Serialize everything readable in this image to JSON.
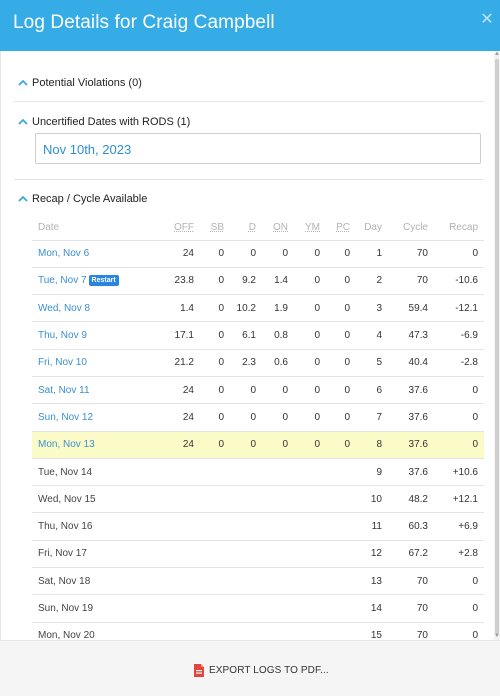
{
  "header": {
    "title": "Log Details for Craig Campbell",
    "close_icon": "close-icon"
  },
  "sections": {
    "violations": {
      "label": "Potential Violations (0)"
    },
    "uncertified": {
      "label": "Uncertified Dates with RODS (1)",
      "date": "Nov 10th, 2023"
    },
    "recap": {
      "label": "Recap / Cycle Available"
    }
  },
  "table": {
    "headers": {
      "date": "Date",
      "off": "OFF",
      "sb": "SB",
      "d": "D",
      "on": "ON",
      "ym": "YM",
      "pc": "PC",
      "day": "Day",
      "cycle": "Cycle",
      "recap": "Recap"
    },
    "rows": [
      {
        "date": "Mon, Nov 6",
        "off": "24",
        "sb": "0",
        "d": "0",
        "on": "0",
        "ym": "0",
        "pc": "0",
        "day": "1",
        "cycle": "70",
        "recap": "0"
      },
      {
        "date": "Tue, Nov 7",
        "badge": "Restart",
        "off": "23.8",
        "sb": "0",
        "d": "9.2",
        "on": "1.4",
        "ym": "0",
        "pc": "0",
        "day": "2",
        "cycle": "70",
        "recap": "-10.6"
      },
      {
        "date": "Wed, Nov 8",
        "off": "1.4",
        "sb": "0",
        "d": "10.2",
        "on": "1.9",
        "ym": "0",
        "pc": "0",
        "day": "3",
        "cycle": "59.4",
        "recap": "-12.1"
      },
      {
        "date": "Thu, Nov 9",
        "off": "17.1",
        "sb": "0",
        "d": "6.1",
        "on": "0.8",
        "ym": "0",
        "pc": "0",
        "day": "4",
        "cycle": "47.3",
        "recap": "-6.9"
      },
      {
        "date": "Fri, Nov 10",
        "off": "21.2",
        "sb": "0",
        "d": "2.3",
        "on": "0.6",
        "ym": "0",
        "pc": "0",
        "day": "5",
        "cycle": "40.4",
        "recap": "-2.8"
      },
      {
        "date": "Sat, Nov 11",
        "off": "24",
        "sb": "0",
        "d": "0",
        "on": "0",
        "ym": "0",
        "pc": "0",
        "day": "6",
        "cycle": "37.6",
        "recap": "0"
      },
      {
        "date": "Sun, Nov 12",
        "off": "24",
        "sb": "0",
        "d": "0",
        "on": "0",
        "ym": "0",
        "pc": "0",
        "day": "7",
        "cycle": "37.6",
        "recap": "0"
      },
      {
        "date": "Mon, Nov 13",
        "off": "24",
        "sb": "0",
        "d": "0",
        "on": "0",
        "ym": "0",
        "pc": "0",
        "day": "8",
        "cycle": "37.6",
        "recap": "0"
      },
      {
        "date": "Tue, Nov 14",
        "day": "9",
        "cycle": "37.6",
        "recap": "+10.6"
      },
      {
        "date": "Wed, Nov 15",
        "day": "10",
        "cycle": "48.2",
        "recap": "+12.1"
      },
      {
        "date": "Thu, Nov 16",
        "day": "11",
        "cycle": "60.3",
        "recap": "+6.9"
      },
      {
        "date": "Fri, Nov 17",
        "day": "12",
        "cycle": "67.2",
        "recap": "+2.8"
      },
      {
        "date": "Sat, Nov 18",
        "day": "13",
        "cycle": "70",
        "recap": "0"
      },
      {
        "date": "Sun, Nov 19",
        "day": "14",
        "cycle": "70",
        "recap": "0"
      },
      {
        "date": "Mon, Nov 20",
        "day": "15",
        "cycle": "70",
        "recap": "0"
      }
    ]
  },
  "footer": {
    "export_label": "EXPORT LOGS TO PDF..."
  },
  "colors": {
    "header_bg": "#35ace6",
    "link": "#3a8fd1",
    "highlight_row": "#fbfbc8",
    "badge": "#2a86dc"
  }
}
